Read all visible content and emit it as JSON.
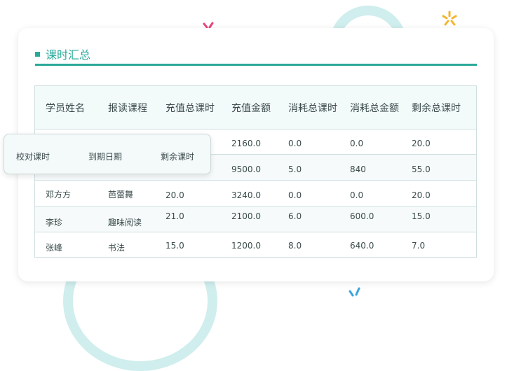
{
  "colors": {
    "accent": "#2aa99b",
    "ring": "#cfeeed",
    "border": "#cfdfe0",
    "confetti_pink": "#e8457a",
    "confetti_yellow": "#f2b62d",
    "confetti_blue": "#3aa5e0"
  },
  "panel": {
    "title": "课时汇总"
  },
  "table": {
    "headers": [
      "学员姓名",
      "报读课程",
      "充值总课时",
      "充值金额",
      "消耗总课时",
      "消耗总金额",
      "剩余总课时"
    ],
    "rows": [
      [
        "",
        "",
        "",
        "2160.0",
        "0.0",
        "0.0",
        "20.0"
      ],
      [
        "",
        "",
        "",
        "9500.0",
        "5.0",
        "840",
        "55.0"
      ],
      [
        "邓方方",
        "芭蕾舞",
        "20.0",
        "3240.0",
        "0.0",
        "0.0",
        "20.0"
      ],
      [
        "李珍",
        "趣味阅读",
        "21.0",
        "2100.0",
        "6.0",
        "600.0",
        "15.0"
      ],
      [
        "张峰",
        "书法",
        "15.0",
        "1200.0",
        "8.0",
        "640.0",
        "7.0"
      ]
    ]
  },
  "popup": {
    "labels": [
      "校对课时",
      "到期日期",
      "剩余课时"
    ]
  }
}
